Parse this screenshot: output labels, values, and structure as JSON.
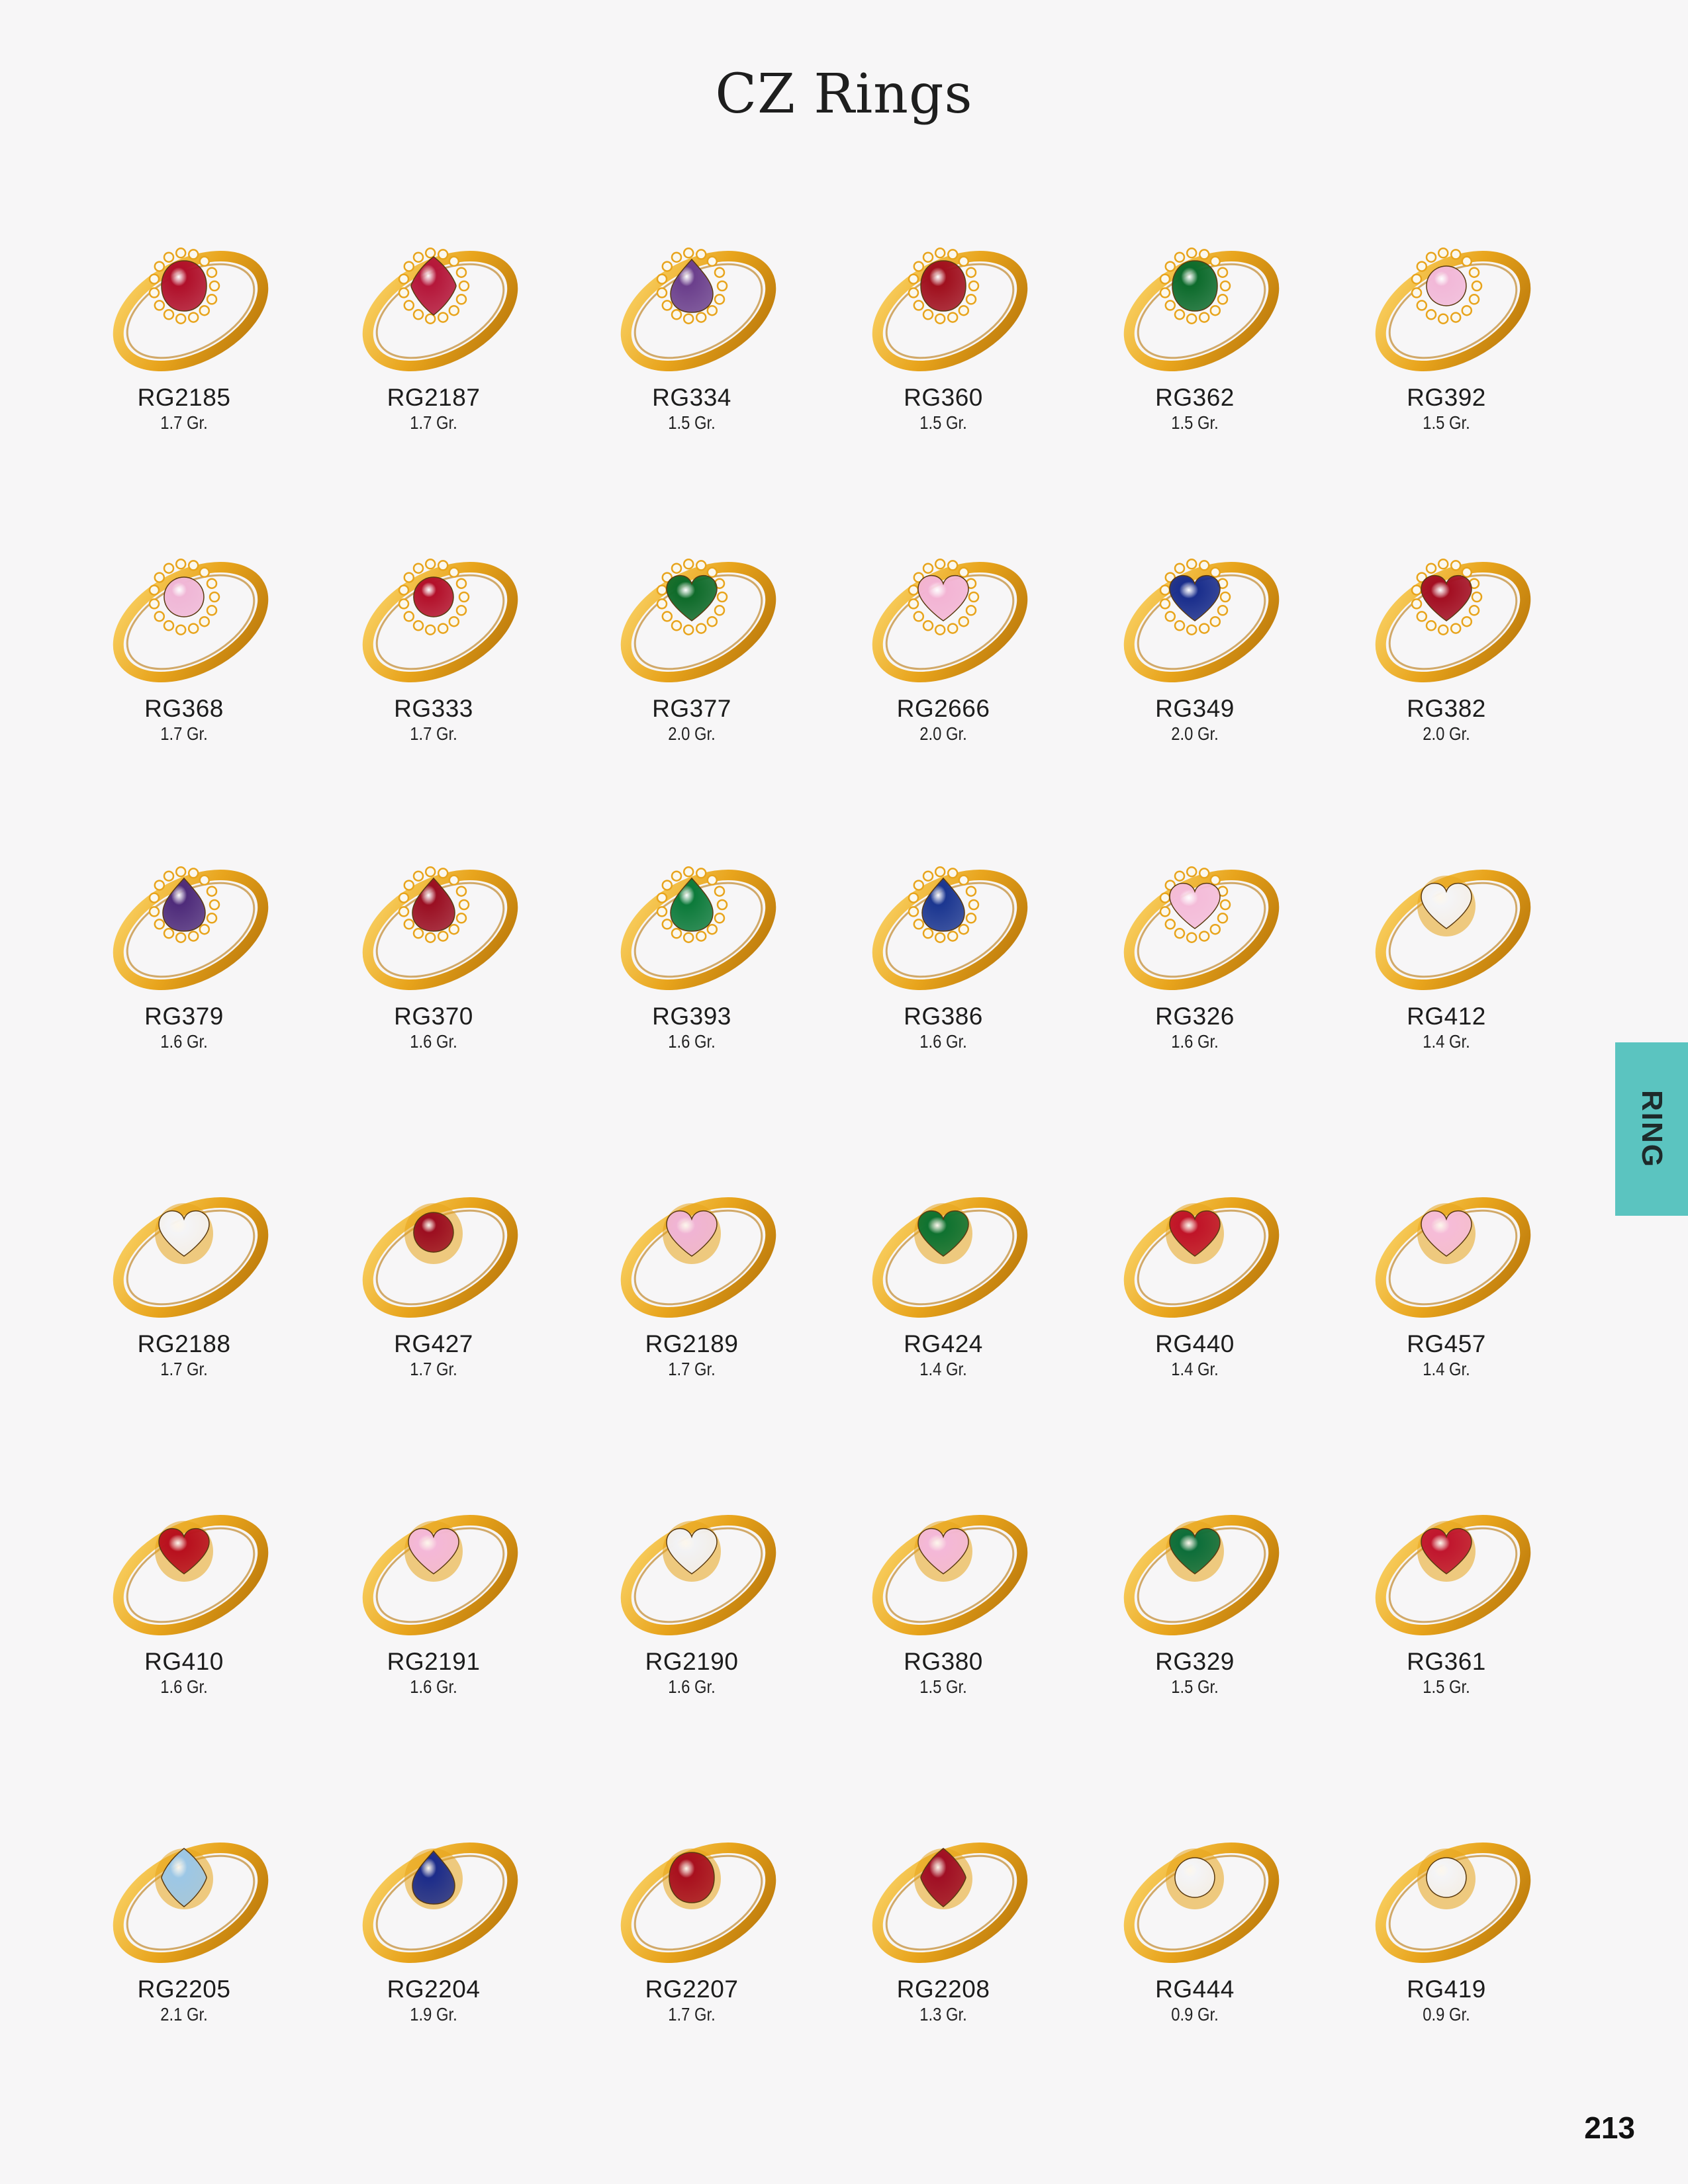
{
  "header": {
    "title": "CZ Rings"
  },
  "side_tab": {
    "label": "RING"
  },
  "footer": {
    "page_number": "213"
  },
  "colors": {
    "background": "#f7f6f7",
    "tab": "#5bc4c0",
    "gold": "#e8a41c",
    "gold_dark": "#b8760a",
    "gold_light": "#fbd56a"
  },
  "rows": [
    {
      "items": [
        {
          "code": "RG2185",
          "weight": "1.7 Gr.",
          "stone": "#b0102a",
          "shape": "oval",
          "halo": true
        },
        {
          "code": "RG2187",
          "weight": "1.7 Gr.",
          "stone": "#b5173a",
          "shape": "marquise",
          "halo": true
        },
        {
          "code": "RG334",
          "weight": "1.5 Gr.",
          "stone": "#6b3f8c",
          "shape": "pear",
          "halo": true
        },
        {
          "code": "RG360",
          "weight": "1.5 Gr.",
          "stone": "#a0101e",
          "shape": "oval",
          "halo": true
        },
        {
          "code": "RG362",
          "weight": "1.5 Gr.",
          "stone": "#0d6b2c",
          "shape": "oval",
          "halo": true
        },
        {
          "code": "RG392",
          "weight": "1.5 Gr.",
          "stone": "#f2b8d8",
          "shape": "round",
          "halo": true
        }
      ]
    },
    {
      "items": [
        {
          "code": "RG368",
          "weight": "1.7 Gr.",
          "stone": "#f0b6d6",
          "shape": "round",
          "halo": true
        },
        {
          "code": "RG333",
          "weight": "1.7 Gr.",
          "stone": "#b3102a",
          "shape": "round",
          "halo": true
        },
        {
          "code": "RG377",
          "weight": "2.0 Gr.",
          "stone": "#0f6b2a",
          "shape": "heart",
          "halo": true
        },
        {
          "code": "RG2666",
          "weight": "2.0 Gr.",
          "stone": "#f3b4d4",
          "shape": "heart",
          "halo": true
        },
        {
          "code": "RG349",
          "weight": "2.0 Gr.",
          "stone": "#1a2e8c",
          "shape": "heart",
          "halo": true
        },
        {
          "code": "RG382",
          "weight": "2.0 Gr.",
          "stone": "#a30f22",
          "shape": "heart",
          "halo": true
        }
      ]
    },
    {
      "items": [
        {
          "code": "RG379",
          "weight": "1.6 Gr.",
          "stone": "#4e2b7a",
          "shape": "pear",
          "halo": true
        },
        {
          "code": "RG370",
          "weight": "1.6 Gr.",
          "stone": "#9a0f22",
          "shape": "pear",
          "halo": true
        },
        {
          "code": "RG393",
          "weight": "1.6 Gr.",
          "stone": "#0c7a3a",
          "shape": "pear",
          "halo": true
        },
        {
          "code": "RG386",
          "weight": "1.6 Gr.",
          "stone": "#1b3690",
          "shape": "pear",
          "halo": true
        },
        {
          "code": "RG326",
          "weight": "1.6 Gr.",
          "stone": "#f4bcd9",
          "shape": "heart",
          "halo": true
        },
        {
          "code": "RG412",
          "weight": "1.4 Gr.",
          "stone": "#f4f4f6",
          "shape": "heart",
          "halo": false
        }
      ]
    },
    {
      "items": [
        {
          "code": "RG2188",
          "weight": "1.7 Gr.",
          "stone": "#f4f4f6",
          "shape": "heart",
          "halo": false
        },
        {
          "code": "RG427",
          "weight": "1.7 Gr.",
          "stone": "#9c0e20",
          "shape": "round",
          "halo": false
        },
        {
          "code": "RG2189",
          "weight": "1.7 Gr.",
          "stone": "#f0b4d4",
          "shape": "heart",
          "halo": false
        },
        {
          "code": "RG424",
          "weight": "1.4 Gr.",
          "stone": "#0f7230",
          "shape": "heart",
          "halo": false
        },
        {
          "code": "RG440",
          "weight": "1.4 Gr.",
          "stone": "#c01428",
          "shape": "heart",
          "halo": false
        },
        {
          "code": "RG457",
          "weight": "1.4 Gr.",
          "stone": "#f6bcd8",
          "shape": "heart",
          "halo": false
        }
      ]
    },
    {
      "items": [
        {
          "code": "RG410",
          "weight": "1.6 Gr.",
          "stone": "#b8101e",
          "shape": "heart",
          "halo": false
        },
        {
          "code": "RG2191",
          "weight": "1.6 Gr.",
          "stone": "#f4b8d8",
          "shape": "heart",
          "halo": false
        },
        {
          "code": "RG2190",
          "weight": "1.6 Gr.",
          "stone": "#f2f2f4",
          "shape": "heart",
          "halo": false
        },
        {
          "code": "RG380",
          "weight": "1.5 Gr.",
          "stone": "#f4b8d8",
          "shape": "heart",
          "halo": false
        },
        {
          "code": "RG329",
          "weight": "1.5 Gr.",
          "stone": "#0d6e3a",
          "shape": "heart",
          "halo": false
        },
        {
          "code": "RG361",
          "weight": "1.5 Gr.",
          "stone": "#c0162e",
          "shape": "heart",
          "halo": false
        }
      ]
    },
    {
      "items": [
        {
          "code": "RG2205",
          "weight": "2.1 Gr.",
          "stone": "#9cc7e6",
          "shape": "marquise",
          "halo": false
        },
        {
          "code": "RG2204",
          "weight": "1.9 Gr.",
          "stone": "#1c2c8a",
          "shape": "pear",
          "halo": false
        },
        {
          "code": "RG2207",
          "weight": "1.7 Gr.",
          "stone": "#a8101e",
          "shape": "oval",
          "halo": false
        },
        {
          "code": "RG2208",
          "weight": "1.3 Gr.",
          "stone": "#a00f24",
          "shape": "marquise",
          "halo": false
        },
        {
          "code": "RG444",
          "weight": "0.9 Gr.",
          "stone": "#f4f4f6",
          "shape": "round",
          "halo": false
        },
        {
          "code": "RG419",
          "weight": "0.9 Gr.",
          "stone": "#f4f4f6",
          "shape": "round",
          "halo": false
        }
      ]
    }
  ]
}
